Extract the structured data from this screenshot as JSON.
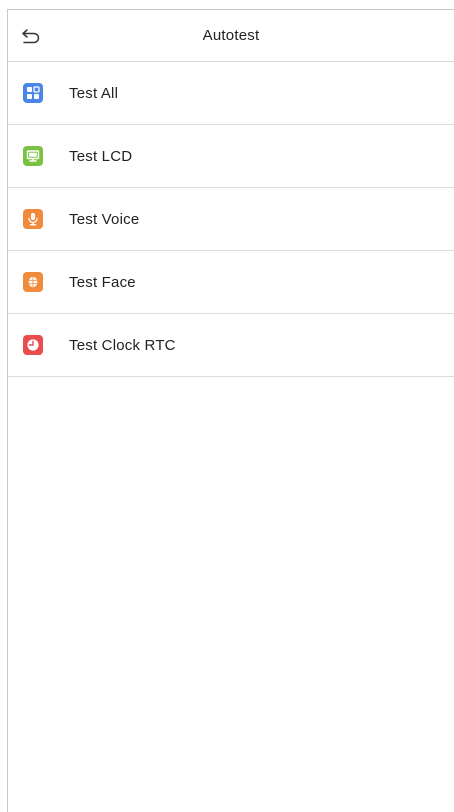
{
  "header": {
    "title": "Autotest",
    "back_icon": "back-arrow-icon"
  },
  "menu": {
    "items": [
      {
        "label": "Test All",
        "icon": "grid-icon",
        "color": "#4a86e8"
      },
      {
        "label": "Test LCD",
        "icon": "monitor-icon",
        "color": "#7cc242"
      },
      {
        "label": "Test Voice",
        "icon": "microphone-icon",
        "color": "#f08a3c"
      },
      {
        "label": "Test Face",
        "icon": "face-icon",
        "color": "#f08a3c"
      },
      {
        "label": "Test Clock RTC",
        "icon": "clock-icon",
        "color": "#ea4d4d"
      }
    ]
  }
}
